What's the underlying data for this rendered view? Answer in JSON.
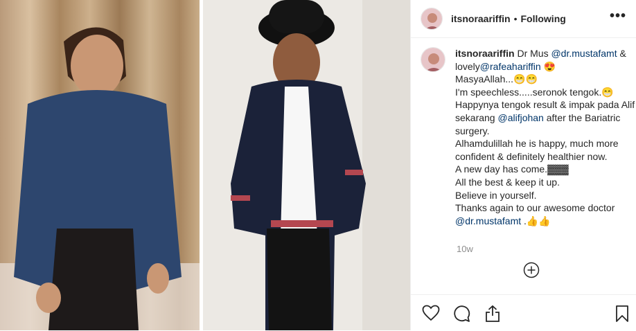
{
  "post": {
    "username": "itsnoraariffin",
    "separator": "•",
    "follow_state": "Following",
    "more_icon": "more-options-icon"
  },
  "caption": {
    "username": "itsnoraariffin",
    "text_1": " Dr Mus ",
    "mention_1": "@dr.mustafamt",
    "text_2": " & lovely",
    "mention_2": "@rafeahariffin",
    "text_3": " 😍\nMasyaAllah...😁😁\nI'm speechless.....seronok tengok.😁\nHappynya tengok result & impak pada Alif sekarang ",
    "mention_3": "@alifjohan",
    "text_4": " after the Bariatric surgery.\nAlhamdulillah he is happy, much more confident & definitely healthier now.\nA new day has come.▓▓▓\nAll the best & keep it up.\nBelieve in yourself.\nThanks again to our awesome doctor\n",
    "mention_4": "@dr.mustafamt",
    "text_5": " .👍👍"
  },
  "time_ago": "10w",
  "icons": {
    "load_more": "plus-circle-icon",
    "like": "heart-icon",
    "comment": "comment-icon",
    "share": "share-icon",
    "save": "bookmark-icon"
  }
}
